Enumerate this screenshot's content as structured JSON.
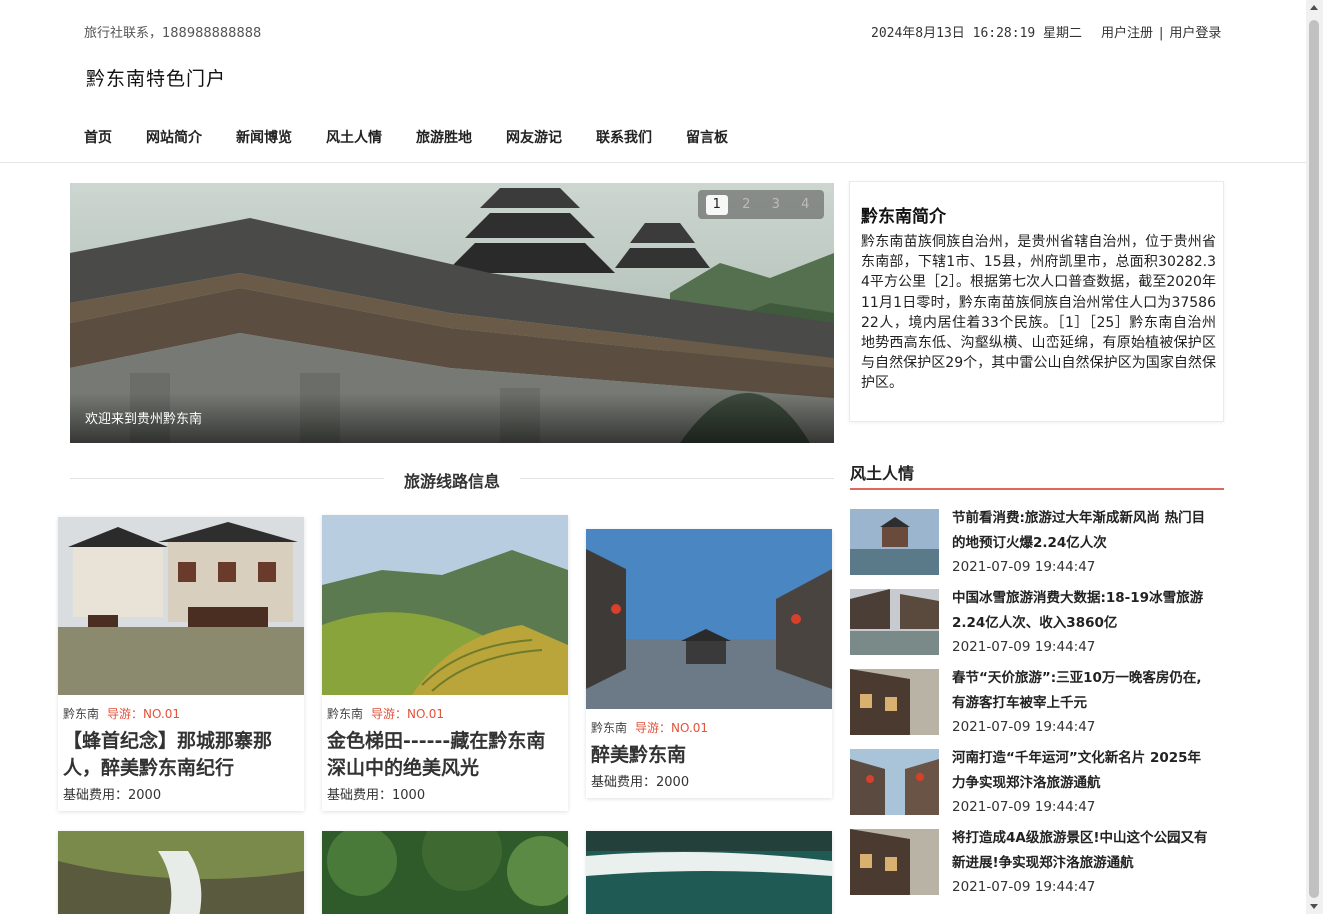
{
  "header": {
    "contact": "旅行社联系，188988888888",
    "datetime": "2024年8月13日 16:28:19 星期二",
    "register": "用户注册",
    "separator": "|",
    "login": "用户登录",
    "site_title": "黔东南特色门户"
  },
  "nav": [
    "首页",
    "网站简介",
    "新闻博览",
    "风土人情",
    "旅游胜地",
    "网友游记",
    "联系我们",
    "留言板"
  ],
  "banner": {
    "caption": "欢迎来到贵州黔东南",
    "pages": [
      "1",
      "2",
      "3",
      "4"
    ],
    "active_page": "1"
  },
  "routes": {
    "heading": "旅游线路信息",
    "cards": [
      {
        "region": "黔东南",
        "guide": "导游：NO.01",
        "title": "【蜂首纪念】那城那寨那人，醉美黔东南纪行",
        "cost": "基础费用：2000"
      },
      {
        "region": "黔东南",
        "guide": "导游：NO.01",
        "title": "金色梯田------藏在黔东南深山中的绝美风光",
        "cost": "基础费用：1000"
      },
      {
        "region": "黔东南",
        "guide": "导游：NO.01",
        "title": "醉美黔东南",
        "cost": "基础费用：2000"
      }
    ]
  },
  "intro": {
    "title": "黔东南简介",
    "body": "黔东南苗族侗族自治州，是贵州省辖自治州，位于贵州省东南部，下辖1市、15县，州府凯里市，总面积30282.34平方公里［2］。根据第七次人口普查数据，截至2020年11月1日零时，黔东南苗族侗族自治州常住人口为3758622人，境内居住着33个民族。［1］［25］黔东南自治州地势西高东低、沟壑纵横、山峦延绵，有原始植被保护区与自然保护区29个，其中雷公山自然保护区为国家自然保护区。"
  },
  "customs": {
    "heading": "风土人情",
    "items": [
      {
        "title": "节前看消费:旅游过大年渐成新风尚 热门目的地预订火爆2.24亿人次",
        "date": "2021-07-09 19:44:47"
      },
      {
        "title": "中国冰雪旅游消费大数据:18-19冰雪旅游2.24亿人次、收入3860亿",
        "date": "2021-07-09 19:44:47"
      },
      {
        "title": "春节“天价旅游”:三亚10万一晚客房仍在,有游客打车被宰上千元",
        "date": "2021-07-09 19:44:47"
      },
      {
        "title": "河南打造“千年运河”文化新名片 2025年力争实现郑汴洛旅游通航",
        "date": "2021-07-09 19:44:47"
      },
      {
        "title": "将打造成4A级旅游景区!中山这个公园又有新进展!争实现郑汴洛旅游通航",
        "date": "2021-07-09 19:44:47"
      }
    ]
  },
  "colors": {
    "accent": "#e3523b",
    "rule": "#e0685a"
  }
}
